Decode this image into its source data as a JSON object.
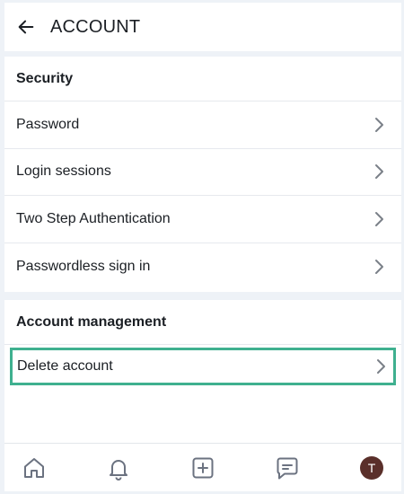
{
  "header": {
    "title": "ACCOUNT",
    "back_icon": "arrow-left-icon"
  },
  "security": {
    "heading": "Security",
    "items": [
      {
        "label": "Password"
      },
      {
        "label": "Login sessions"
      },
      {
        "label": "Two Step Authentication"
      },
      {
        "label": "Passwordless sign in"
      }
    ]
  },
  "account_management": {
    "heading": "Account management",
    "items": [
      {
        "label": "Delete account"
      }
    ]
  },
  "bottom_nav": {
    "items": [
      "home-icon",
      "bell-icon",
      "add-square-icon",
      "message-icon",
      "avatar"
    ],
    "avatar_initial": "T"
  },
  "colors": {
    "highlight": "#3fb08f",
    "avatar": "#5a2f2a",
    "background": "#eef2f7"
  }
}
